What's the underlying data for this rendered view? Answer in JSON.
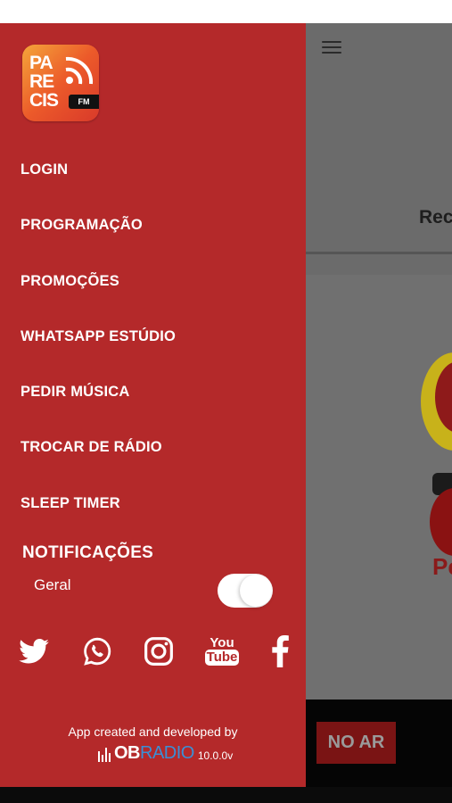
{
  "app": {
    "logo_text": [
      "PA",
      "RE",
      "CIS"
    ],
    "logo_badge": "FM"
  },
  "menu": {
    "items": [
      {
        "label": "LOGIN"
      },
      {
        "label": "PROGRAMAÇÃO"
      },
      {
        "label": "PROMOÇÕES"
      },
      {
        "label": "WHATSAPP ESTÚDIO"
      },
      {
        "label": "PEDIR MÚSICA"
      },
      {
        "label": "TROCAR DE RÁDIO"
      },
      {
        "label": "SLEEP TIMER"
      }
    ]
  },
  "notifications": {
    "title": "NOTIFICAÇÕES",
    "general_label": "Geral",
    "general_enabled": true
  },
  "social": {
    "icons": [
      "twitter-icon",
      "whatsapp-icon",
      "instagram-icon",
      "youtube-icon",
      "facebook-icon"
    ],
    "youtube_top": "You",
    "youtube_bottom": "Tube"
  },
  "footer": {
    "credit": "App created and developed by",
    "brand_ob": "OB",
    "brand_radio": "RADIO",
    "version": "10.0.0v"
  },
  "main": {
    "header_partial": "Rec",
    "title_partial": "Pe",
    "on_air_label": "NO AR"
  },
  "colors": {
    "drawer_bg": "#b4292a",
    "overlay": "#707070",
    "on_air_bg": "#7a1414",
    "brand_blue": "#3a8fd6"
  }
}
